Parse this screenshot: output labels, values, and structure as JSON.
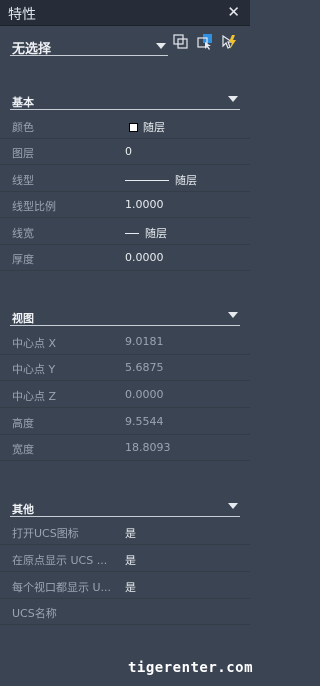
{
  "window": {
    "title": "特性",
    "close_icon": "close-icon"
  },
  "selection": {
    "label": "无选择",
    "tools": [
      {
        "name": "toggle-pickadd-icon"
      },
      {
        "name": "select-objects-icon"
      },
      {
        "name": "quick-select-icon"
      }
    ]
  },
  "sections": {
    "general": {
      "title": "基本",
      "rows": [
        {
          "name": "颜色",
          "value": "随层"
        },
        {
          "name": "图层",
          "value": "0"
        },
        {
          "name": "线型",
          "value": "随层"
        },
        {
          "name": "线型比例",
          "value": "1.0000"
        },
        {
          "name": "线宽",
          "value": "随层"
        },
        {
          "name": "厚度",
          "value": "0.0000"
        }
      ]
    },
    "view": {
      "title": "视图",
      "rows": [
        {
          "name": "中心点 X",
          "value": "9.0181"
        },
        {
          "name": "中心点 Y",
          "value": "5.6875"
        },
        {
          "name": "中心点 Z",
          "value": "0.0000"
        },
        {
          "name": "高度",
          "value": "9.5544"
        },
        {
          "name": "宽度",
          "value": "18.8093"
        }
      ]
    },
    "misc": {
      "title": "其他",
      "rows": [
        {
          "name": "打开UCS图标",
          "value": "是"
        },
        {
          "name": "在原点显示 UCS ...",
          "value": "是"
        },
        {
          "name": "每个视口都显示 U...",
          "value": "是"
        },
        {
          "name": "UCS名称",
          "value": ""
        }
      ]
    }
  },
  "colors": {
    "panel_bg": "#3b4453",
    "titlebar_bg": "#262d38",
    "swatch": "#ffffff"
  },
  "watermark": "tigerenter.com"
}
